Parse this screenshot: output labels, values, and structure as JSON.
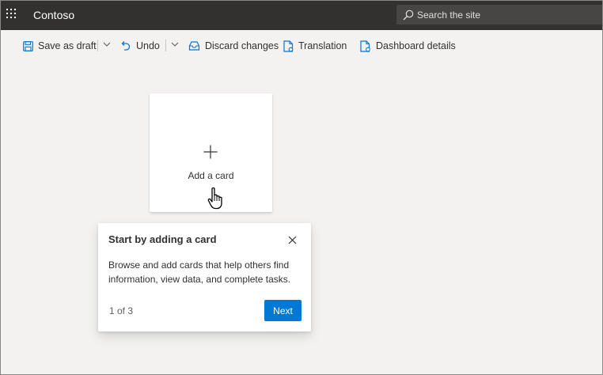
{
  "app": {
    "name": "Contoso"
  },
  "search": {
    "placeholder": "Search the site"
  },
  "toolbar": {
    "save_as_draft": "Save as draft",
    "undo": "Undo",
    "discard_changes": "Discard changes",
    "translation": "Translation",
    "dashboard_details": "Dashboard details"
  },
  "card": {
    "label": "Add a card"
  },
  "callout": {
    "title": "Start by adding a card",
    "body": "Browse and add cards that help others find information, view data, and complete tasks.",
    "step": "1 of 3",
    "next_label": "Next"
  },
  "colors": {
    "topbar": "#323130",
    "search_bg": "#484644",
    "canvas": "#f3f2f1",
    "accent": "#0078d4",
    "text": "#323130"
  },
  "icons": [
    "waffle-icon",
    "search-icon",
    "save-icon",
    "chevron-down-icon",
    "undo-icon",
    "discard-icon",
    "translation-icon",
    "dashboard-details-icon",
    "plus-icon",
    "close-icon",
    "hand-pointer-icon"
  ]
}
